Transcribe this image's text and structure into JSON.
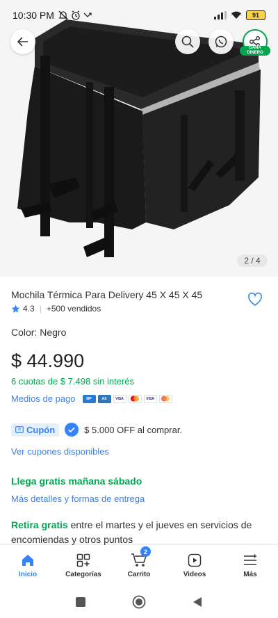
{
  "status_bar": {
    "time": "10:30 PM",
    "battery": "91"
  },
  "gallery": {
    "counter": "2 / 4",
    "earn_badge_line1": "GANA",
    "earn_badge_line2": "DINERO"
  },
  "product": {
    "title": "Mochila Térmica Para Delivery 45 X 45 X 45",
    "rating": "4.3",
    "sold": "+500 vendidos",
    "color_label": "Color: Negro",
    "price": "$ 44.990",
    "installments": "6 cuotas de $ 7.498 sin interés",
    "payment_link": "Medios de pago",
    "cards": [
      "VISA",
      "VISA",
      ""
    ]
  },
  "coupon": {
    "tag": "Cupón",
    "text": "$ 5.000 OFF al comprar.",
    "link": "Ver cupones disponibles"
  },
  "shipping": {
    "arrival": "Llega gratis mañana sábado",
    "details_link": "Más detalles y formas de entrega",
    "pickup_bold": "Retira gratis",
    "pickup_rest": " entre el martes y el jueves en servicios de encomiendas y otros puntos"
  },
  "bottom_nav": {
    "items": [
      {
        "label": "Inicio",
        "icon": "home-icon"
      },
      {
        "label": "Categorías",
        "icon": "categories-icon"
      },
      {
        "label": "Carrito",
        "icon": "cart-icon"
      },
      {
        "label": "Videos",
        "icon": "video-icon"
      },
      {
        "label": "Más",
        "icon": "menu-icon"
      }
    ],
    "cart_count": "2"
  },
  "colors": {
    "accent_blue": "#3483fa",
    "accent_green": "#00a650"
  }
}
